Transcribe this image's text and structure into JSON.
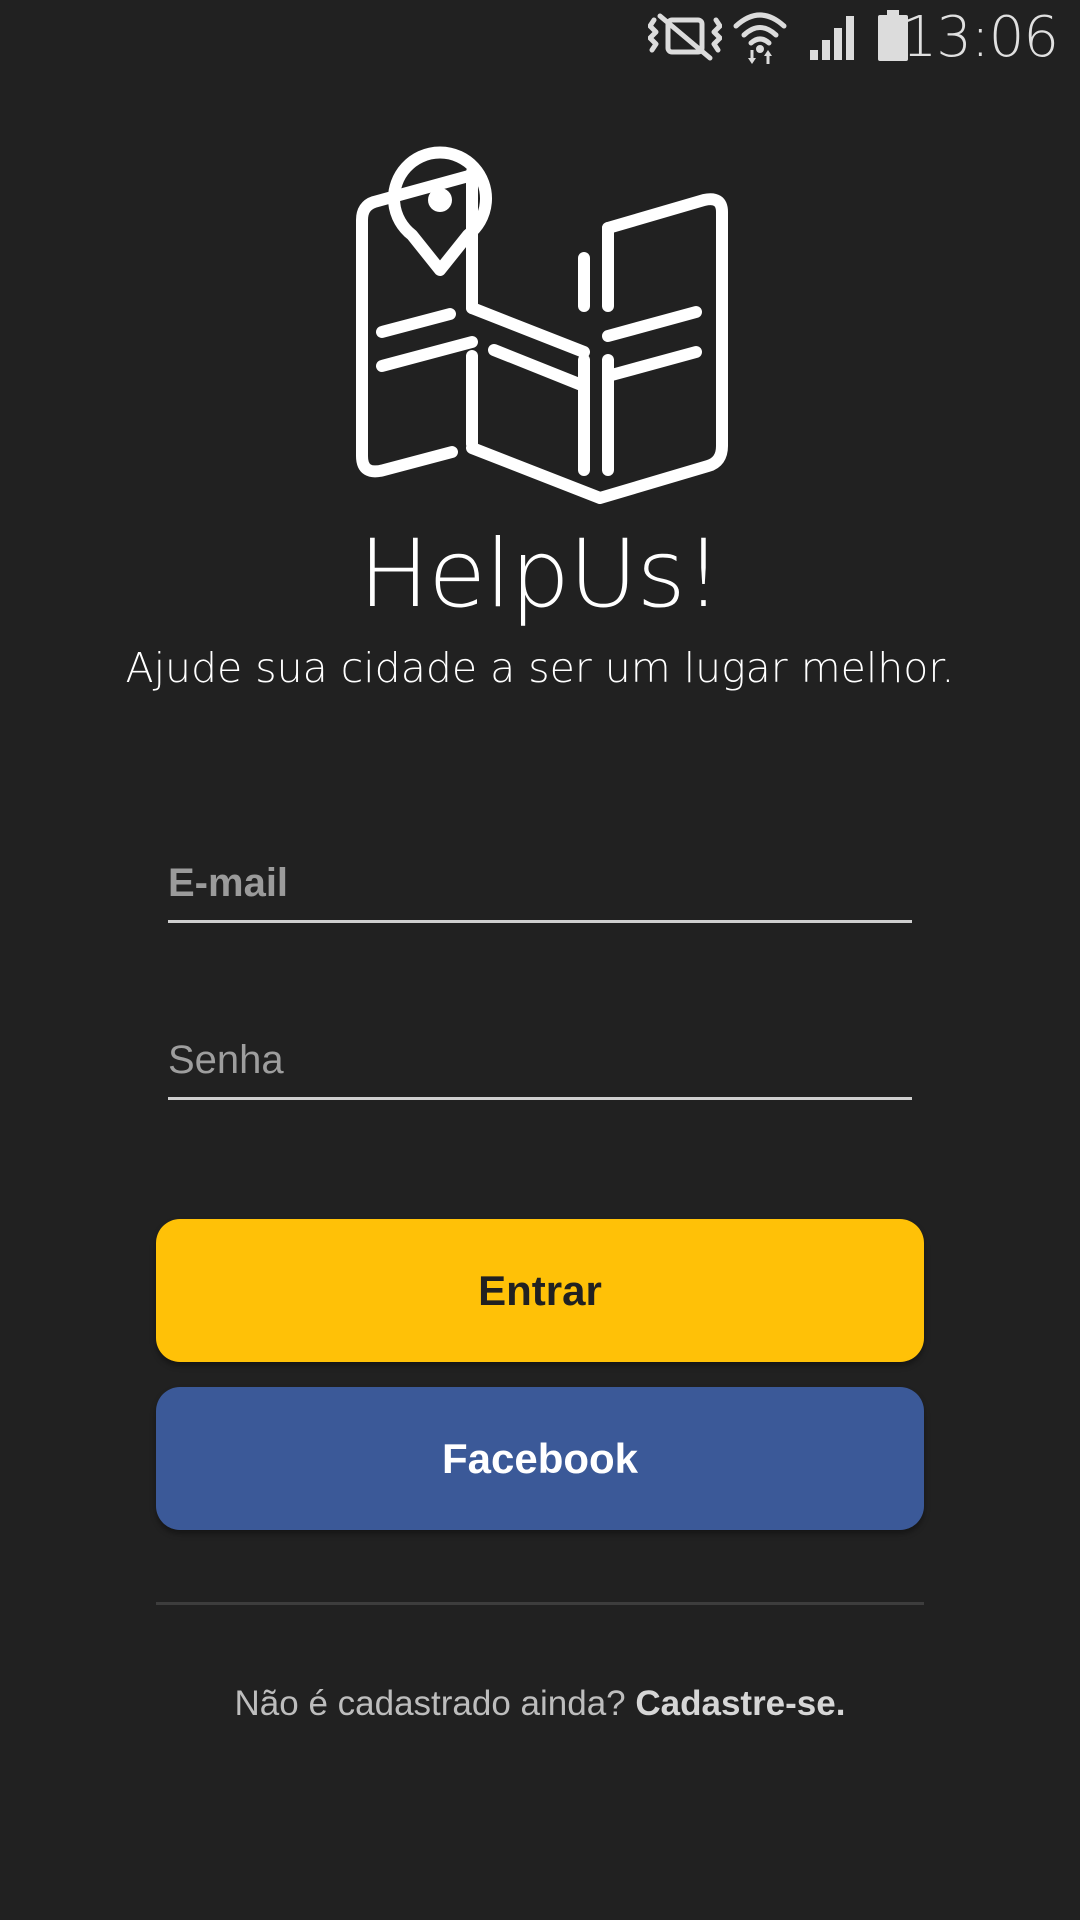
{
  "status_bar": {
    "time": "13:06",
    "icons": [
      "vibrate-mute-icon",
      "wifi-icon",
      "signal-icon",
      "battery-icon"
    ]
  },
  "app": {
    "logo_icon": "map-pin-icon",
    "title": "HelpUs!",
    "subtitle": "Ajude sua cidade a ser um lugar melhor."
  },
  "form": {
    "email_placeholder": "E-mail",
    "email_value": "",
    "password_placeholder": "Senha",
    "password_value": ""
  },
  "buttons": {
    "login_label": "Entrar",
    "facebook_label": "Facebook"
  },
  "signup": {
    "prompt": "Não é cadastrado ainda? ",
    "link_label": "Cadastre-se."
  },
  "colors": {
    "background": "#212121",
    "login_button": "#ffc107",
    "facebook_button": "#3b5998"
  }
}
